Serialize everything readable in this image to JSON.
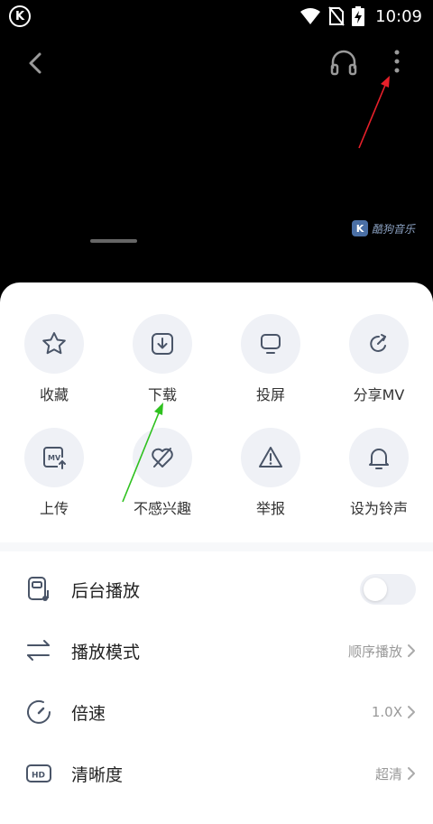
{
  "status_bar": {
    "app_logo_letter": "K",
    "time": "10:09",
    "icons": [
      "wifi-icon",
      "no-sim-icon",
      "battery-charging-icon"
    ]
  },
  "video": {
    "watermark_logo": "K",
    "watermark_text": "酷狗音乐",
    "icons": [
      "back-icon",
      "headphones-icon",
      "more-vertical-icon"
    ]
  },
  "actions": [
    {
      "label": "收藏",
      "icon": "star-icon"
    },
    {
      "label": "下载",
      "icon": "download-icon"
    },
    {
      "label": "投屏",
      "icon": "cast-screen-icon"
    },
    {
      "label": "分享MV",
      "icon": "share-icon"
    },
    {
      "label": "上传",
      "icon": "upload-mv-icon"
    },
    {
      "label": "不感兴趣",
      "icon": "not-interested-icon"
    },
    {
      "label": "举报",
      "icon": "report-icon"
    },
    {
      "label": "设为铃声",
      "icon": "ringtone-bell-icon"
    }
  ],
  "settings": {
    "background_play": {
      "label": "后台播放",
      "icon": "background-play-icon",
      "toggle_on": false
    },
    "play_mode": {
      "label": "播放模式",
      "value": "顺序播放",
      "icon": "play-order-icon"
    },
    "speed": {
      "label": "倍速",
      "value": "1.0X",
      "icon": "speed-gauge-icon"
    },
    "quality": {
      "label": "清晰度",
      "value": "超清",
      "icon": "hd-icon"
    }
  },
  "colors": {
    "sheet_bg": "#ffffff",
    "circle_bg": "#eff1f6",
    "icon_stroke": "#4a5568",
    "annotation_red": "#e8202a",
    "annotation_green": "#2ec11e"
  }
}
